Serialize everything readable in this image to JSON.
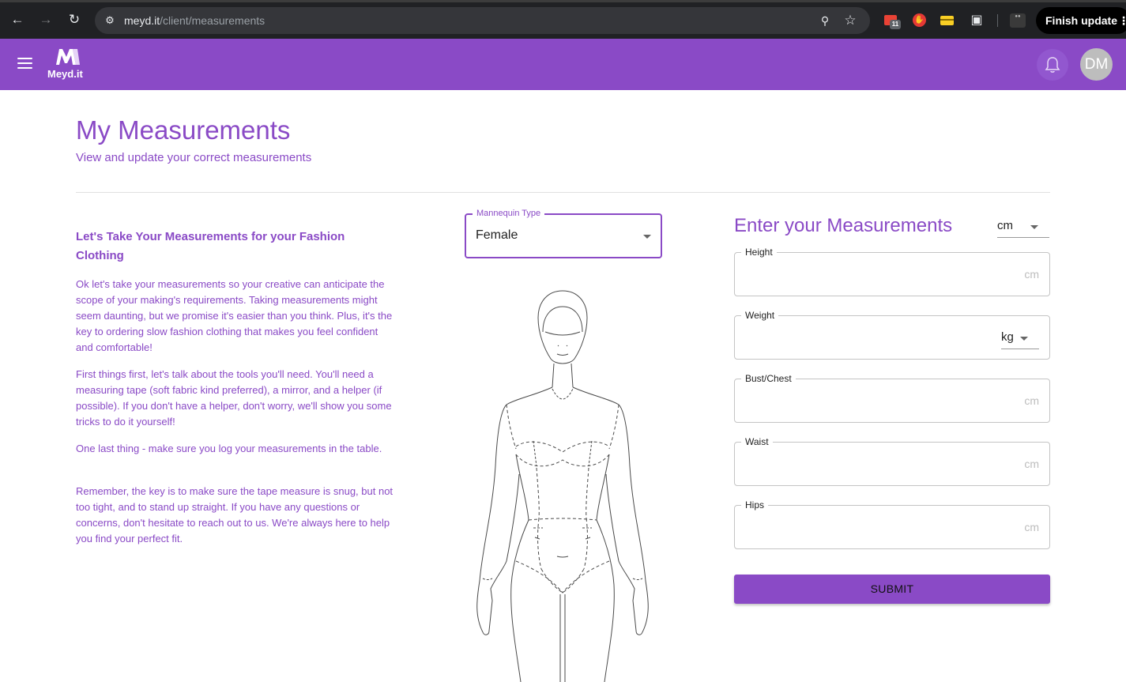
{
  "browser": {
    "url_host": "meyd.it",
    "url_path": "/client/measurements",
    "gmail_badge": "11",
    "finish_update_label": "Finish update",
    "icons": [
      "back-arrow-icon",
      "forward-arrow-icon",
      "reload-icon",
      "site-settings-icon",
      "key-icon",
      "star-icon",
      "gmail-icon",
      "stop-icon",
      "card-icon",
      "puzzle-icon",
      "more-vert-icon"
    ]
  },
  "appbar": {
    "logo_text": "Meyd.it",
    "avatar_initials": "DM",
    "color": "#8a4ac6",
    "icons": [
      "menu-icon",
      "bell-icon"
    ]
  },
  "page": {
    "title": "My Measurements",
    "subtitle": "View and update your correct measurements"
  },
  "intro": {
    "title": "Let's Take Your Measurements for your Fashion Clothing",
    "paragraphs": [
      "Ok let's take your measurements so your creative can anticipate the scope of your making's requirements. Taking measurements might seem daunting, but we promise it's easier than you think. Plus, it's the key to ordering slow fashion clothing that makes you feel confident and comfortable!",
      "First things first, let's talk about the tools you'll need. You'll need a measuring tape (soft fabric kind preferred), a mirror, and a helper (if possible). If you don't have a helper, don't worry, we'll show you some tricks to do it yourself!",
      "One last thing - make sure you log your measurements in the table.",
      "Remember, the key is to make sure the tape measure is snug, but not too tight, and to stand up straight. If you have any questions or concerns, don't hesitate to reach out to us. We're always here to help you find your perfect fit."
    ]
  },
  "mannequin": {
    "label": "Mannequin Type",
    "value": "Female"
  },
  "form": {
    "title": "Enter your Measurements",
    "unit": "cm",
    "fields": [
      {
        "label": "Height",
        "unit": "cm"
      },
      {
        "label": "Weight",
        "unit": "kg"
      },
      {
        "label": "Bust/Chest",
        "unit": "cm"
      },
      {
        "label": "Waist",
        "unit": "cm"
      },
      {
        "label": "Hips",
        "unit": "cm"
      }
    ],
    "submit_label": "SUBMIT"
  }
}
